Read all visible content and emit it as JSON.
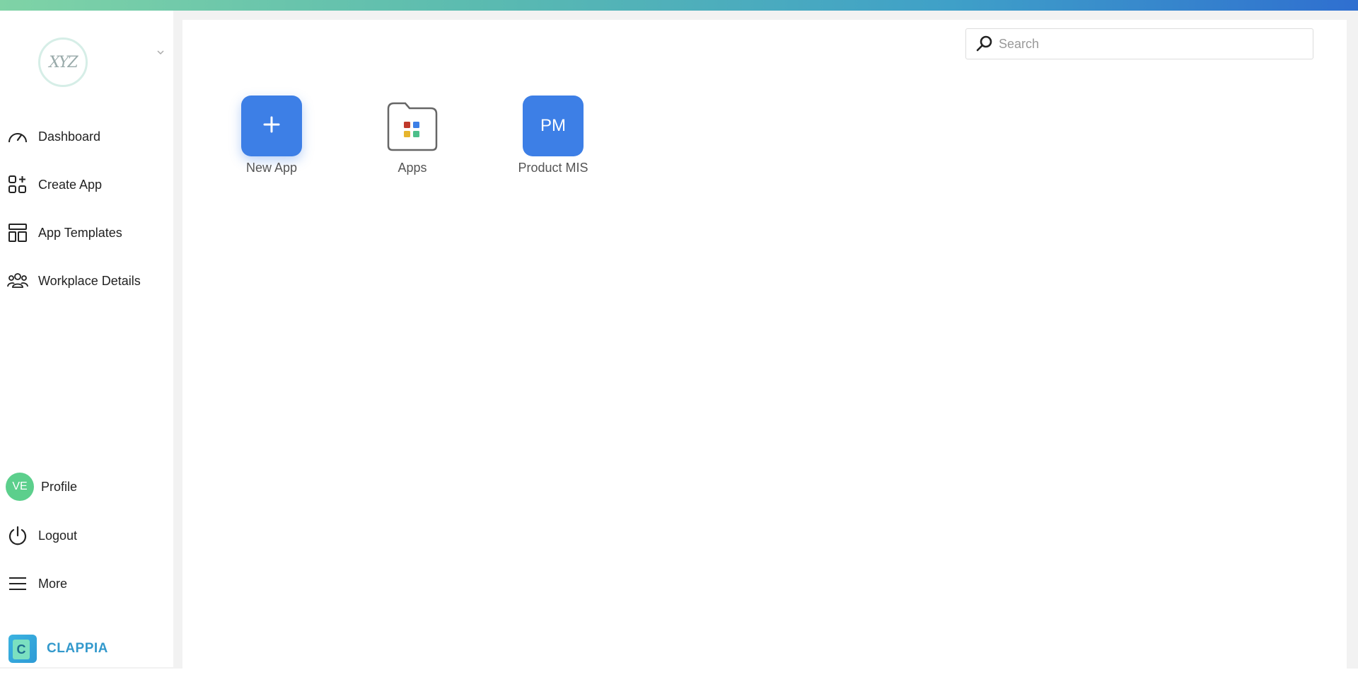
{
  "colors": {
    "accent": "#3d7fe6",
    "avatar_bg": "#5ccf8c",
    "brand": "#3399cc"
  },
  "workspace": {
    "logo_text": "XYZ",
    "dropdown_icon": "chevron-down-icon"
  },
  "sidebar": {
    "items": [
      {
        "label": "Dashboard",
        "icon": "dashboard-gauge-icon"
      },
      {
        "label": "Create App",
        "icon": "create-app-icon"
      },
      {
        "label": "App Templates",
        "icon": "templates-icon"
      },
      {
        "label": "Workplace Details",
        "icon": "people-group-icon"
      }
    ],
    "bottom": [
      {
        "label": "Profile",
        "avatar": "VE"
      },
      {
        "label": "Logout",
        "icon": "power-icon"
      },
      {
        "label": "More",
        "icon": "hamburger-menu-icon"
      }
    ],
    "brand": {
      "name": "CLAPPIA",
      "mark": "C"
    }
  },
  "search": {
    "placeholder": "Search",
    "value": ""
  },
  "apps": [
    {
      "label": "New App",
      "icon": "plus-icon"
    },
    {
      "label": "Apps",
      "icon": "folder-apps-icon"
    },
    {
      "label": "Product MIS",
      "initials": "PM"
    }
  ]
}
